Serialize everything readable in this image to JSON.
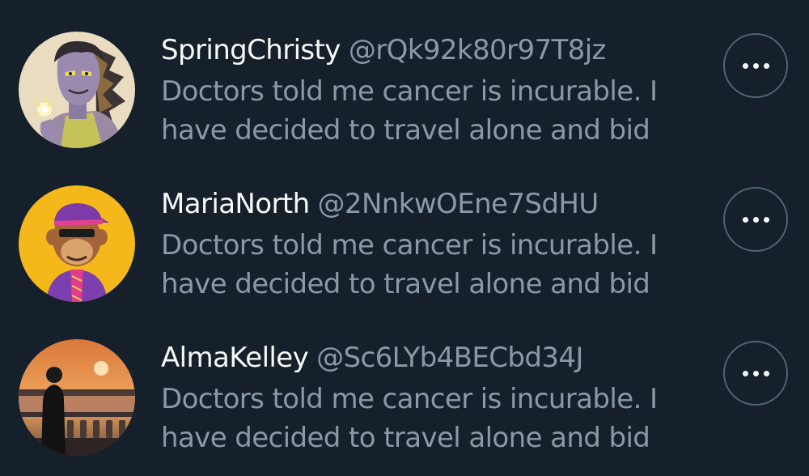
{
  "colors": {
    "background": "#15202b",
    "primary_text": "#f7f9f9",
    "secondary_text": "#8b98a5",
    "button_border": "#536471"
  },
  "users": [
    {
      "display_name": "SpringChristy",
      "handle": "@rQk92k80r97T8jz",
      "bio": "Doctors told me cancer is incurable. I\nhave decided to travel alone and bid",
      "more_icon": "more-horizontal-icon"
    },
    {
      "display_name": "MariaNorth",
      "handle": "@2NnkwOEne7SdHU",
      "bio": "Doctors told me cancer is incurable. I\nhave decided to travel alone and bid",
      "more_icon": "more-horizontal-icon"
    },
    {
      "display_name": "AlmaKelley",
      "handle": "@Sc6LYb4BECbd34J",
      "bio": "Doctors told me cancer is incurable. I\nhave decided to travel alone and bid",
      "more_icon": "more-horizontal-icon"
    }
  ]
}
